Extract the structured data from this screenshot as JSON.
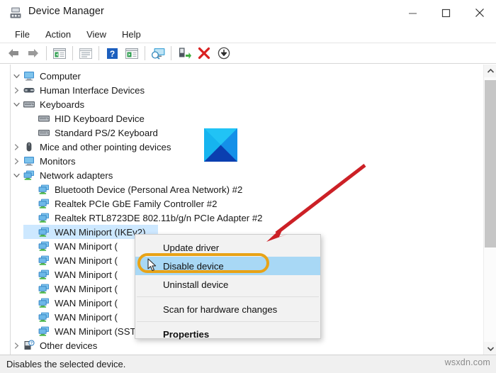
{
  "window": {
    "title": "Device Manager",
    "icon": "device-manager-icon",
    "buttons": {
      "minimize": "minimize-icon",
      "maximize": "maximize-icon",
      "close": "close-icon"
    }
  },
  "menubar": {
    "items": [
      {
        "label": "File"
      },
      {
        "label": "Action"
      },
      {
        "label": "View"
      },
      {
        "label": "Help"
      }
    ]
  },
  "toolbar": {
    "buttons": [
      {
        "name": "back-arrow-icon",
        "tip": "Back"
      },
      {
        "name": "forward-arrow-icon",
        "tip": "Forward"
      },
      {
        "name": "show-hide-console-tree-icon",
        "tip": "Show/Hide console tree"
      },
      {
        "name": "properties-icon",
        "tip": "Properties"
      },
      {
        "name": "help-icon",
        "tip": "Help"
      },
      {
        "name": "update-driver-icon",
        "tip": "Update driver"
      },
      {
        "name": "scan-hardware-changes-icon",
        "tip": "Scan for hardware changes"
      },
      {
        "name": "enable-device-icon",
        "tip": "Enable device"
      },
      {
        "name": "uninstall-device-icon",
        "tip": "Uninstall device"
      },
      {
        "name": "disable-device-icon",
        "tip": "Disable device"
      }
    ]
  },
  "tree": {
    "rows": [
      {
        "label": "Computer",
        "indent": 0,
        "chev": "expanded",
        "icon": "computer-icon",
        "selected": false
      },
      {
        "label": "Human Interface Devices",
        "indent": 0,
        "chev": "collapsed",
        "icon": "hid-icon",
        "selected": false
      },
      {
        "label": "Keyboards",
        "indent": 0,
        "chev": "expanded",
        "icon": "keyboard-icon",
        "selected": false
      },
      {
        "label": "HID Keyboard Device",
        "indent": 1,
        "chev": "none",
        "icon": "keyboard-icon",
        "selected": false
      },
      {
        "label": "Standard PS/2 Keyboard",
        "indent": 1,
        "chev": "none",
        "icon": "keyboard-icon",
        "selected": false
      },
      {
        "label": "Mice and other pointing devices",
        "indent": 0,
        "chev": "collapsed",
        "icon": "mouse-icon",
        "selected": false
      },
      {
        "label": "Monitors",
        "indent": 0,
        "chev": "collapsed",
        "icon": "monitor-icon",
        "selected": false
      },
      {
        "label": "Network adapters",
        "indent": 0,
        "chev": "expanded",
        "icon": "network-icon",
        "selected": false
      },
      {
        "label": "Bluetooth Device (Personal Area Network) #2",
        "indent": 1,
        "chev": "none",
        "icon": "network-icon",
        "selected": false
      },
      {
        "label": "Realtek PCIe GbE Family Controller #2",
        "indent": 1,
        "chev": "none",
        "icon": "network-icon",
        "selected": false
      },
      {
        "label": "Realtek RTL8723DE 802.11b/g/n PCIe Adapter #2",
        "indent": 1,
        "chev": "none",
        "icon": "network-icon",
        "selected": false
      },
      {
        "label": "WAN Miniport (IKEv2)",
        "indent": 1,
        "chev": "none",
        "icon": "network-icon",
        "selected": true
      },
      {
        "label": "WAN Miniport (",
        "indent": 1,
        "chev": "none",
        "icon": "network-icon",
        "selected": false
      },
      {
        "label": "WAN Miniport (",
        "indent": 1,
        "chev": "none",
        "icon": "network-icon",
        "selected": false
      },
      {
        "label": "WAN Miniport (",
        "indent": 1,
        "chev": "none",
        "icon": "network-icon",
        "selected": false
      },
      {
        "label": "WAN Miniport (",
        "indent": 1,
        "chev": "none",
        "icon": "network-icon",
        "selected": false
      },
      {
        "label": "WAN Miniport (",
        "indent": 1,
        "chev": "none",
        "icon": "network-icon",
        "selected": false
      },
      {
        "label": "WAN Miniport (",
        "indent": 1,
        "chev": "none",
        "icon": "network-icon",
        "selected": false
      },
      {
        "label": "WAN Miniport (SSTP)",
        "indent": 1,
        "chev": "none",
        "icon": "network-icon",
        "selected": false
      },
      {
        "label": "Other devices",
        "indent": 0,
        "chev": "collapsed",
        "icon": "unknown-device-icon",
        "selected": false
      }
    ]
  },
  "context_menu": {
    "items": [
      {
        "label": "Update driver",
        "highlighted": false,
        "bold": false
      },
      {
        "label": "Disable device",
        "highlighted": true,
        "bold": false
      },
      {
        "label": "Uninstall device",
        "highlighted": false,
        "bold": false
      },
      {
        "label": "Scan for hardware changes",
        "highlighted": false,
        "bold": false
      },
      {
        "label": "Properties",
        "highlighted": false,
        "bold": true
      }
    ]
  },
  "annotations": {
    "highlight_box": {
      "name": "disable-device-highlight",
      "color": "#e8a317"
    },
    "arrow": {
      "name": "red-pointer-arrow",
      "color": "#cc2026"
    },
    "logo": {
      "name": "blue-x-logo",
      "colors": [
        "#21c3f5",
        "#0a9fe0",
        "#1060d8",
        "#0b3fb0"
      ]
    },
    "cursor": {
      "name": "mouse-cursor"
    }
  },
  "statusbar": {
    "text": "Disables the selected device."
  },
  "watermark": {
    "text": "wsxdn.com"
  },
  "scrollbar": {
    "up": "scroll-up-arrow-icon",
    "down": "scroll-down-arrow-icon",
    "thumb": "scroll-thumb"
  }
}
